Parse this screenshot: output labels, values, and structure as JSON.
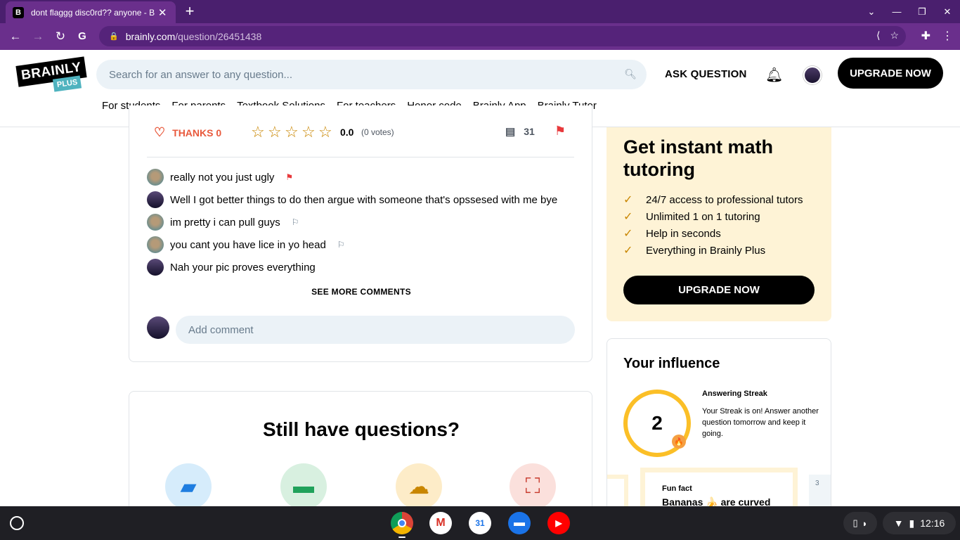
{
  "browser": {
    "tab_title": "dont flaggg disc0rd?? anyone - B",
    "tab_favicon": "B",
    "url_host": "brainly.com",
    "url_path": "/question/26451438"
  },
  "header": {
    "logo_main": "BRAINLY",
    "logo_plus": "PLUS",
    "search_placeholder": "Search for an answer to any question...",
    "ask_label": "ASK QUESTION",
    "upgrade_label": "UPGRADE NOW",
    "nav": [
      "For students",
      "For parents",
      "Textbook Solutions",
      "For teachers",
      "Honor code",
      "Brainly App",
      "Brainly Tutor"
    ]
  },
  "answer": {
    "thanks_label": "THANKS 0",
    "rating": "0.0",
    "votes": "(0 votes)",
    "comment_count": "31",
    "stars_filled": 0,
    "stars_total": 5
  },
  "comments": [
    {
      "text": "really not you just ugly",
      "avatar": "a",
      "flag": "red"
    },
    {
      "text": "Well I got better things to do then argue with someone that's opssesed with me bye",
      "avatar": "b",
      "flag": "none"
    },
    {
      "text": "im pretty i can pull guys",
      "avatar": "a",
      "flag": "grey"
    },
    {
      "text": "you cant you have lice in yo head",
      "avatar": "a",
      "flag": "grey"
    },
    {
      "text": "Nah your pic proves everything",
      "avatar": "b",
      "flag": "none"
    }
  ],
  "see_more_label": "SEE MORE COMMENTS",
  "add_comment_placeholder": "Add comment",
  "still_title": "Still have questions?",
  "promo": {
    "title": "Get instant math tutoring",
    "items": [
      "24/7 access to professional tutors",
      "Unlimited 1 on 1 tutoring",
      "Help in seconds",
      "Everything in Brainly Plus"
    ],
    "button_label": "UPGRADE NOW"
  },
  "influence": {
    "title": "Your influence",
    "streak_count": "2",
    "streak_title": "Answering Streak",
    "streak_text": "Your Streak is on! Answer another question tomorrow and keep it going.",
    "fun_fact_label": "Fun fact",
    "fun_fact_text": "Bananas 🍌 are curved",
    "card_index": "3"
  },
  "shelf": {
    "time": "12:16"
  },
  "colors": {
    "browser_dark": "#4a1f6e",
    "browser_toolbar": "#6a2f8c",
    "accent_red": "#e8593c",
    "star_gold": "#c98600",
    "promo_bg": "#fef3d6",
    "search_bg": "#ebf2f7"
  }
}
